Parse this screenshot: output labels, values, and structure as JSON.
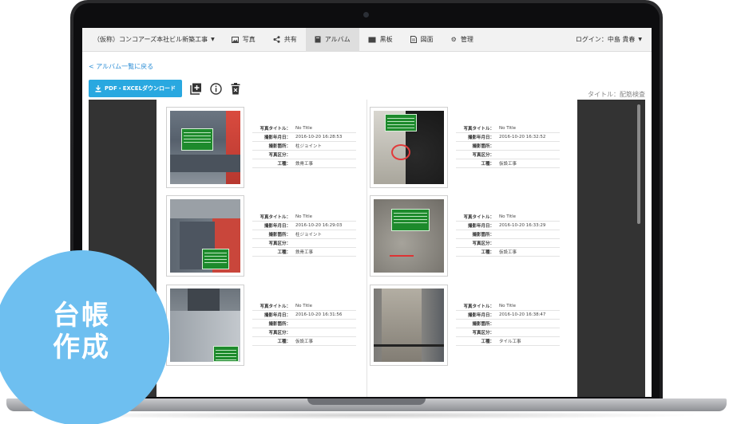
{
  "nav": {
    "project": "（仮称）コンコアーズ本社ビル新築工事",
    "items": [
      {
        "label": "写真",
        "icon": "image-icon"
      },
      {
        "label": "共有",
        "icon": "share-icon"
      },
      {
        "label": "アルバム",
        "icon": "album-icon"
      },
      {
        "label": "黒板",
        "icon": "blackboard-icon"
      },
      {
        "label": "図面",
        "icon": "drawing-icon"
      },
      {
        "label": "管理",
        "icon": "gear-icon"
      }
    ],
    "active": "アルバム",
    "login": "ログイン：中島 貴春"
  },
  "back_link": "< アルバム一覧に戻る",
  "toolbar": {
    "download_label": "PDF・EXCELダウンロード",
    "title": "タイトル：配筋検査"
  },
  "field_labels": {
    "title": "写真タイトル：",
    "date": "撮影年月日：",
    "place": "撮影箇所：",
    "category": "写真区分：",
    "work": "工種："
  },
  "photos": [
    {
      "title": "No Title",
      "date": "2016-10-20 16:28:53",
      "place": "柱ジョイント",
      "category": "",
      "work": "鉄骨工事"
    },
    {
      "title": "No Title",
      "date": "2016-10-20 16:32:52",
      "place": "",
      "category": "",
      "work": "仮設工事"
    },
    {
      "title": "No Title",
      "date": "2016-10-20 16:29:03",
      "place": "柱ジョイント",
      "category": "",
      "work": "鉄骨工事"
    },
    {
      "title": "No Title",
      "date": "2016-10-20 16:33:29",
      "place": "",
      "category": "",
      "work": "仮設工事"
    },
    {
      "title": "No Title",
      "date": "2016-10-20 16:31:56",
      "place": "",
      "category": "",
      "work": "仮設工事"
    },
    {
      "title": "No Title",
      "date": "2016-10-20 16:38:47",
      "place": "",
      "category": "",
      "work": "タイル工事"
    }
  ],
  "badge": {
    "line1": "台帳",
    "line2": "作成"
  },
  "colors": {
    "accent": "#29a8e0",
    "link": "#2c8ed6",
    "badge": "#6ebff0",
    "board": "#1d8a2c"
  }
}
